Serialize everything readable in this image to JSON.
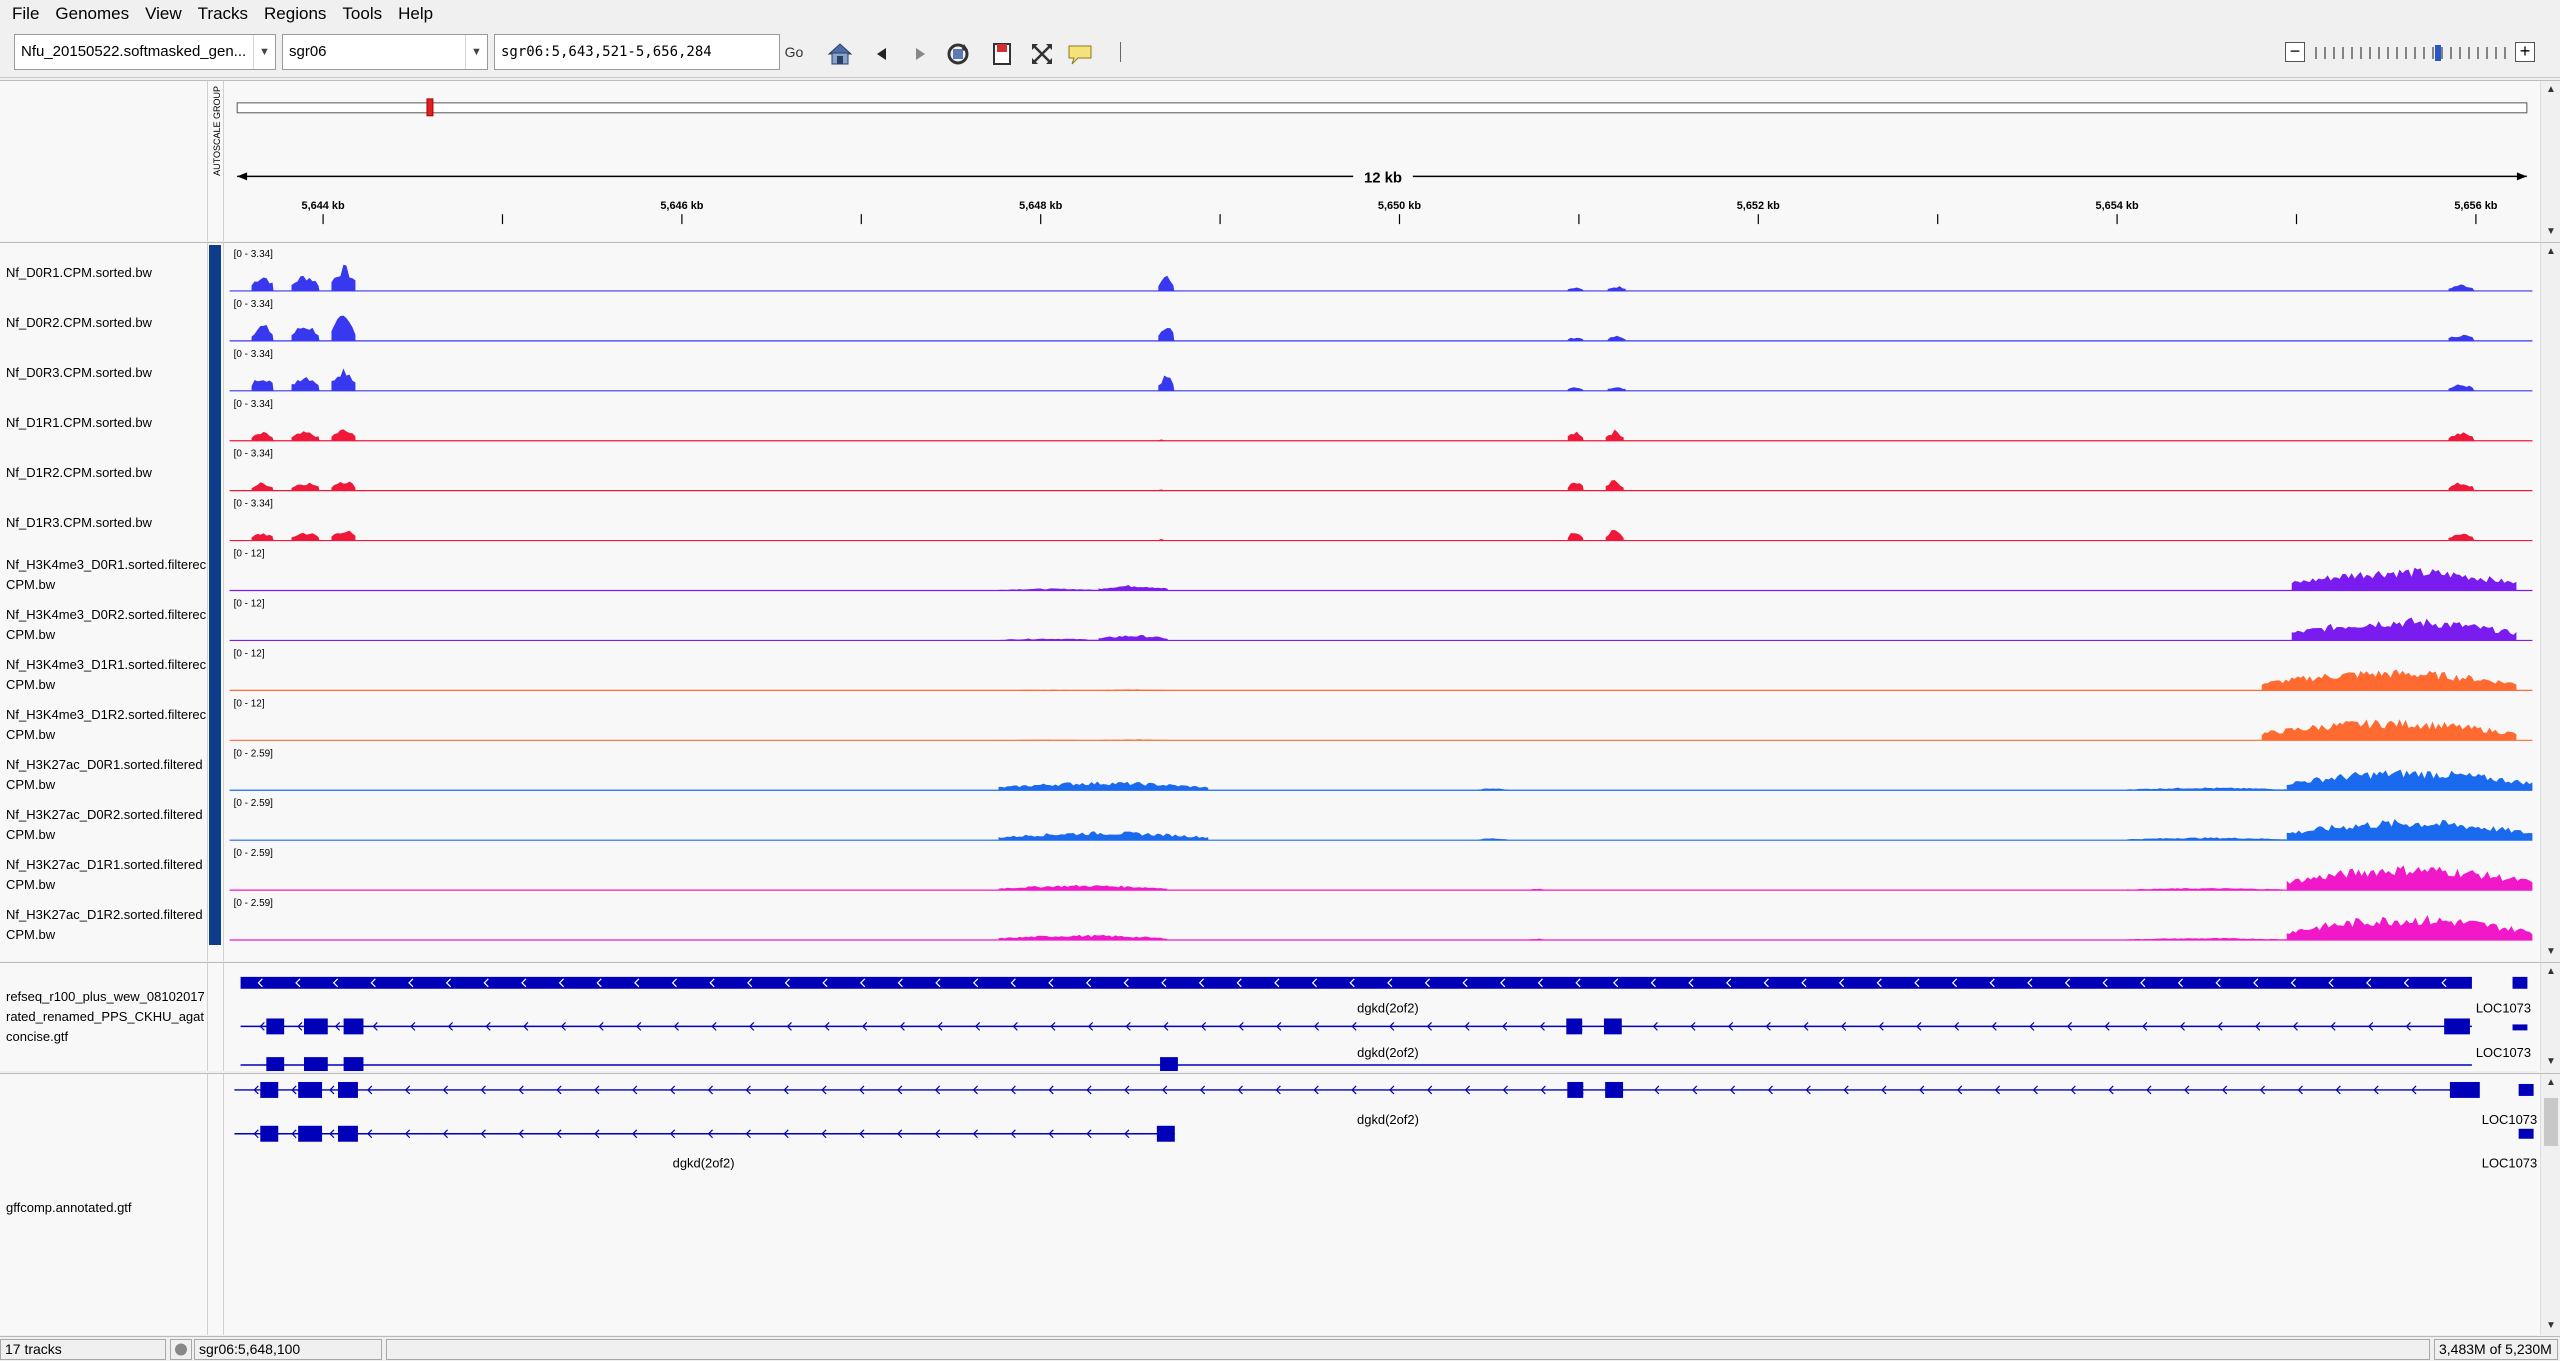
{
  "menu": [
    "File",
    "Genomes",
    "View",
    "Tracks",
    "Regions",
    "Tools",
    "Help"
  ],
  "toolbar": {
    "genome": "Nfu_20150522.softmasked_gen...",
    "chromosome": "sgr06",
    "locus": "sgr06:5,643,521-5,656,284",
    "go_label": "Go"
  },
  "ruler": {
    "span_label": "12 kb",
    "attribute_header": "AUTOSCALE GROUP",
    "ticks": [
      "5,644 kb",
      "5,646 kb",
      "5,648 kb",
      "5,650 kb",
      "5,652 kb",
      "5,654 kb",
      "5,656 kb"
    ]
  },
  "tracks": [
    {
      "name": "Nf_D0R1.CPM.sorted.bw",
      "range": "[0 - 3.34]",
      "color": "#3838f0"
    },
    {
      "name": "Nf_D0R2.CPM.sorted.bw",
      "range": "[0 - 3.34]",
      "color": "#3838f0"
    },
    {
      "name": "Nf_D0R3.CPM.sorted.bw",
      "range": "[0 - 3.34]",
      "color": "#3838f0"
    },
    {
      "name": "Nf_D1R1.CPM.sorted.bw",
      "range": "[0 - 3.34]",
      "color": "#f01838"
    },
    {
      "name": "Nf_D1R2.CPM.sorted.bw",
      "range": "[0 - 3.34]",
      "color": "#f01838"
    },
    {
      "name": "Nf_D1R3.CPM.sorted.bw",
      "range": "[0 - 3.34]",
      "color": "#f01838"
    },
    {
      "name": "Nf_H3K4me3_D0R1.sorted.filterec\nCPM.bw",
      "range": "[0 - 12]",
      "color": "#7a1cf0"
    },
    {
      "name": "Nf_H3K4me3_D0R2.sorted.filterec\nCPM.bw",
      "range": "[0 - 12]",
      "color": "#7a1cf0"
    },
    {
      "name": "Nf_H3K4me3_D1R1.sorted.filterec\nCPM.bw",
      "range": "[0 - 12]",
      "color": "#ff6a30"
    },
    {
      "name": "Nf_H3K4me3_D1R2.sorted.filterec\nCPM.bw",
      "range": "[0 - 12]",
      "color": "#ff6a30"
    },
    {
      "name": "Nf_H3K27ac_D0R1.sorted.filtered\nCPM.bw",
      "range": "[0 - 2.59]",
      "color": "#1a6af0"
    },
    {
      "name": "Nf_H3K27ac_D0R2.sorted.filtered\nCPM.bw",
      "range": "[0 - 2.59]",
      "color": "#1a6af0"
    },
    {
      "name": "Nf_H3K27ac_D1R1.sorted.filtered\nCPM.bw",
      "range": "[0 - 2.59]",
      "color": "#f018c8"
    },
    {
      "name": "Nf_H3K27ac_D1R2.sorted.filtered\nCPM.bw",
      "range": "[0 - 2.59]",
      "color": "#f018c8"
    }
  ],
  "annotation1": {
    "name": "refseq_r100_plus_wew_08102017\nrated_renamed_PPS_CKHU_agat\nconcise.gtf",
    "labels": [
      "dgkd(2of2)",
      "LOC1073",
      "dgkd(2of2)",
      "LOC1073"
    ]
  },
  "annotation2": {
    "name": "gffcomp.annotated.gtf",
    "labels": [
      "dgkd(2of2)",
      "LOC1073",
      "dgkd(2of2)",
      "LOC1073"
    ]
  },
  "status": {
    "track_count": "17 tracks",
    "position": "sgr06:5,648,100",
    "memory": "3,483M of 5,230M"
  }
}
